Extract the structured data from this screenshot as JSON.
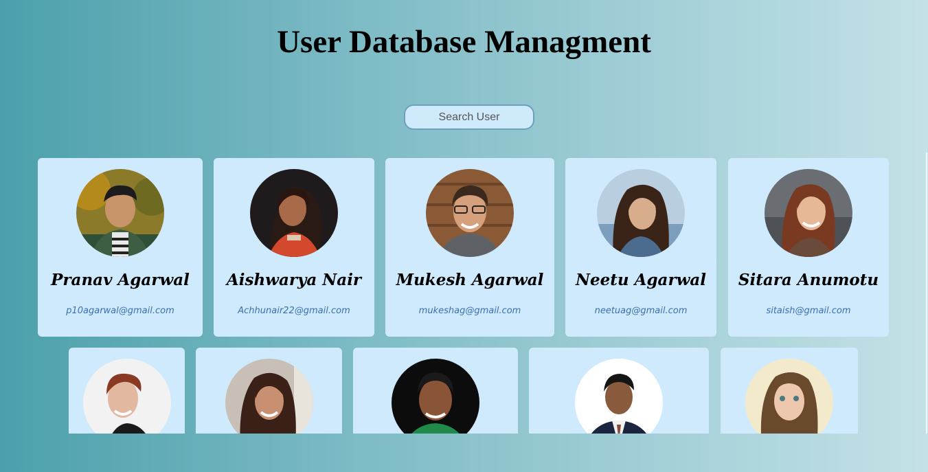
{
  "header": {
    "title": "User Database Managment"
  },
  "search": {
    "placeholder": "Search User",
    "value": ""
  },
  "users": [
    {
      "name": "Pranav Agarwal",
      "email": "p10agarwal@gmail.com"
    },
    {
      "name": "Aishwarya Nair",
      "email": "Achhunair22@gmail.com"
    },
    {
      "name": "Mukesh Agarwal",
      "email": "mukeshag@gmail.com"
    },
    {
      "name": "Neetu Agarwal",
      "email": "neetuag@gmail.com"
    },
    {
      "name": "Sitara Anumotu",
      "email": "sitaish@gmail.com"
    }
  ]
}
